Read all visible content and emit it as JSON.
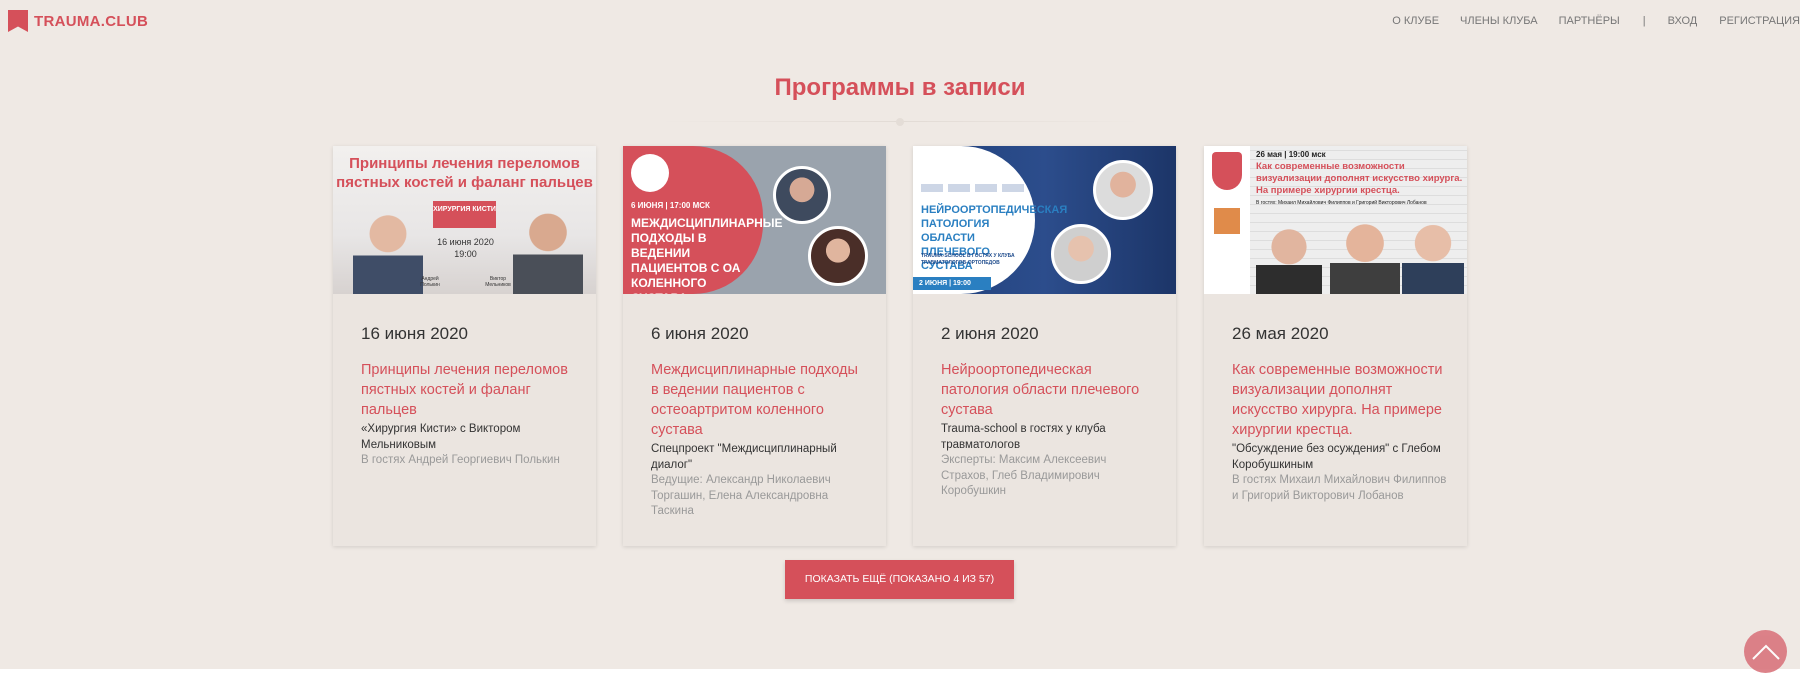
{
  "header": {
    "logo_text": "TRAUMA.CLUB",
    "nav": {
      "about": "О КЛУБЕ",
      "members": "ЧЛЕНЫ КЛУБА",
      "partners": "ПАРТНЁРЫ",
      "separator": "|",
      "login": "ВХОД",
      "register": "РЕГИСТРАЦИЯ"
    }
  },
  "main": {
    "section_title": "Программы в записи",
    "cards": [
      {
        "date": "16 июня 2020",
        "title": "Принципы лечения переломов пястных костей и фаланг пальцев",
        "subtitle": "«Хирургия Кисти» с Виктором Мельниковым",
        "guests": "В гостях Андрей Георгиевич Полькин",
        "thumb": {
          "heading": "Принципы лечения переломов пястных костей и фаланг пальцев",
          "badge": "ХИРУРГИЯ КИСТИ",
          "date": "16 июня 2020",
          "time": "19:00",
          "name_left": "Андрей Полькин",
          "name_right": "Виктор Мельников"
        }
      },
      {
        "date": "6 июня 2020",
        "title": "Междисциплинарные подходы в ведении пациентов с остеоартритом коленного сустава",
        "subtitle": "Спецпроект \"Междисциплинарный диалог\"",
        "guests": "Ведущие: Александр Николаевич Торгашин, Елена Александровна Таскина",
        "thumb": {
          "date": "6 ИЮНЯ | 17:00 МСК",
          "heading": "МЕЖДИСЦИПЛИНАРНЫЕ ПОДХОДЫ В ВЕДЕНИИ ПАЦИЕНТОВ С ОА КОЛЕННОГО СУСТАВА"
        }
      },
      {
        "date": "2 июня 2020",
        "title": "Нейроортопедическая патология области плечевого сустава",
        "subtitle": "Trauma-school в гостях у клуба травматологов",
        "guests": "Эксперты: Максим Алексеевич Страхов, Глеб Владимирович Коробушкин",
        "thumb": {
          "heading": "НЕЙРООРТОПЕДИЧЕСКАЯ ПАТОЛОГИЯ ОБЛАСТИ ПЛЕЧЕВОГО СУСТАВА",
          "sub": "TRAUMA-SCHOOL В ГОСТЯХ У КЛУБА ТРАВМАТОЛОГОВ-ОРТОПЕДОВ",
          "bar": "2 ИЮНЯ | 19:00"
        }
      },
      {
        "date": "26 мая 2020",
        "title": "Как современные возможности визуализации дополнят искусство хирурга. На примере хирургии крестца.",
        "subtitle": "\"Обсуждение без осуждения\" с Глебом Коробушкиным",
        "guests": "В гостях Михаил Михайлович Филиппов и Григорий Викторович Лобанов",
        "thumb": {
          "date": "26 мая | 19:00 мск",
          "heading": "Как современные возможности визуализации дополнят искусство хирурга. На примере хирургии крестца.",
          "sub": "В гостях: Михаил Михайлович Филиппов и Григорий Викторович Лобанов"
        }
      }
    ],
    "show_more": "ПОКАЗАТЬ ЕЩЁ (ПОКАЗАНО 4 ИЗ 57)"
  },
  "colors": {
    "accent": "#d5505a",
    "background": "#efe9e4"
  },
  "icons": {
    "logo": "bookmark-icon",
    "scroll_top": "chevron-up-icon"
  }
}
